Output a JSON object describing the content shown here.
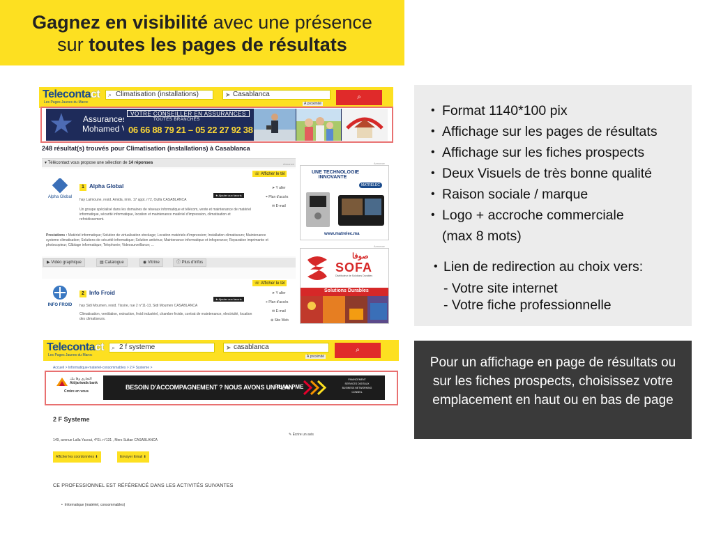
{
  "headline": {
    "part1_bold": "Gagnez en visibilité",
    "part2": " avec une présence",
    "part3": "sur ",
    "part4_bold": "toutes les pages de résultats"
  },
  "shot1": {
    "logo": "Teleconta",
    "logo_sub": "Les Pages Jaunes du Maroc",
    "search_what": "Climatisation (installations)",
    "search_where": "Casablanca",
    "proximity": "À proximité",
    "banner": {
      "brand_line1": "Assurances",
      "brand_line2": "Mohamed V",
      "line1": "VOTRE CONSEILLER EN ASSURANCES",
      "line2": "TOUTES BRANCHES",
      "phones": "06 66 88 79 21 – 05 22 27 92 38"
    },
    "results_count": "248 résultat(s) trouvés pour Climatisation (installations) à Casablanca",
    "selection_text": "▾ Télécontact vous propose une sélection de ",
    "selection_bold": "14 réponses",
    "annonce": "Annonce",
    "item1": {
      "number": "1",
      "name": "Alpha Global",
      "logo_text": "Alpha Global",
      "show_phone": "Afficher le tél",
      "address": "hay Laimoune, resid. Amida, imm. 17 appt. n°2, Oulfa CASABLANCA",
      "favorite": "Ajouter aux favoris",
      "goto": "Y aller",
      "map": "Plan d'accès",
      "email": "E-mail",
      "description": "Un groupe spécialisé dans les domaines de réseaux informatique et télécom, vente et maintenance de matériel informatique, sécurité informatique, location et maintenance matériel d'impression, climatisation et refroidissement.",
      "services_label": "Prestations :",
      "services": "Matériel informatique;  Solution de virtualisation stockage;  Location matériels d'impression;  Installation climatiseurs;  Maintenance systeme climatisation;  Solutions de sécurité informatique;  Solution antivirus;  Maintenance informatique et infogerance;  Reparation imprimante et photocopieur;  Câblage informatique;  Telephonie;  Videosurveillance;  ...",
      "tabs": [
        "Vidéo graphique",
        "Catalogue",
        "Vitrine",
        "Plus d'infos"
      ]
    },
    "item2": {
      "number": "2",
      "name": "Info Froid",
      "logo_text": "INFO FROID",
      "show_phone": "Afficher le tél",
      "address": "hay Sidi Moumen, resid. Tissire, rue 2 n°11-13, Sidi Moumen CASABLANCA",
      "favorite": "Ajouter aux favoris",
      "goto": "Y aller",
      "map": "Plan d'accès",
      "email": "E-mail",
      "site": "Site Web",
      "description": "Climatisation, ventilation, extraction, froid industriel, chambre froide, contrat de maintenance, electricité, location des climatiseurs."
    },
    "ad1": {
      "line1": "UNE TECHNOLOGIE",
      "line2": "INNOVANTE",
      "brand": "MATRELEC",
      "url": "www.matrelec.ma"
    },
    "ad2": {
      "brand": "SOFA",
      "arabic": "صوفا",
      "sub": "Distributeur de Solutions Durables",
      "tag": "Solutions Durables"
    }
  },
  "shot2": {
    "logo": "Teleconta",
    "logo_sub": "Les Pages Jaunes du Maroc",
    "search_what": "2 f systeme",
    "search_where": "casablanca",
    "proximity": "À proximité",
    "breadcrumb": "Accueil > Informatique-materiel-consommables > 2 F Systeme >",
    "banner": {
      "bank": "Attijariwafa bank",
      "bank_arabic": "التجاري وفا بنك",
      "bank_slogan": "Croire en vous",
      "headline": "BESOIN D'ACCOMPAGNEMENT ? NOUS AVONS UN PLAN",
      "plan": "PLAN PME",
      "services": [
        "FINANCEMENT",
        "SERVICES DIGITAUX",
        "BUSINESS NETWORKING",
        "CONSEIL"
      ]
    },
    "title": "2 F Systeme",
    "address": "149, avenue Lalla Yacout, 4°Et. n°131 , Mers Sultan     CASABLANCA",
    "review": "Écrire un avis",
    "btn_coords": "Afficher les coordonnées",
    "btn_email": "Envoyer Email",
    "section": "CE PROFESSIONNEL EST RÉFÉRENCÉ DANS LES ACTIVITÉS SUIVANTES",
    "activity": "Informatique (matériel, consommables)"
  },
  "features": {
    "items": [
      "Format 1140*100 pix",
      "Affichage sur les pages de résultats",
      "Affichage sur les fiches prospects",
      "Deux Visuels de très bonne qualité",
      "Raison sociale / marque",
      "Logo + accroche commerciale"
    ],
    "logo_cont": "(max 8 mots)",
    "link_title": "Lien de redirection au choix vers:",
    "link_options": [
      "- Votre site internet",
      "- Votre fiche professionnelle"
    ]
  },
  "note": "Pour un affichage en page de résultats ou sur les fiches prospects, choisissez votre emplacement en haut ou en bas de page",
  "colors": {
    "yellow": "#fde021",
    "red_frame": "#e87070",
    "search_button": "#e02a2a",
    "panel_gray": "#ececec",
    "panel_dark": "#3a3a3a"
  }
}
